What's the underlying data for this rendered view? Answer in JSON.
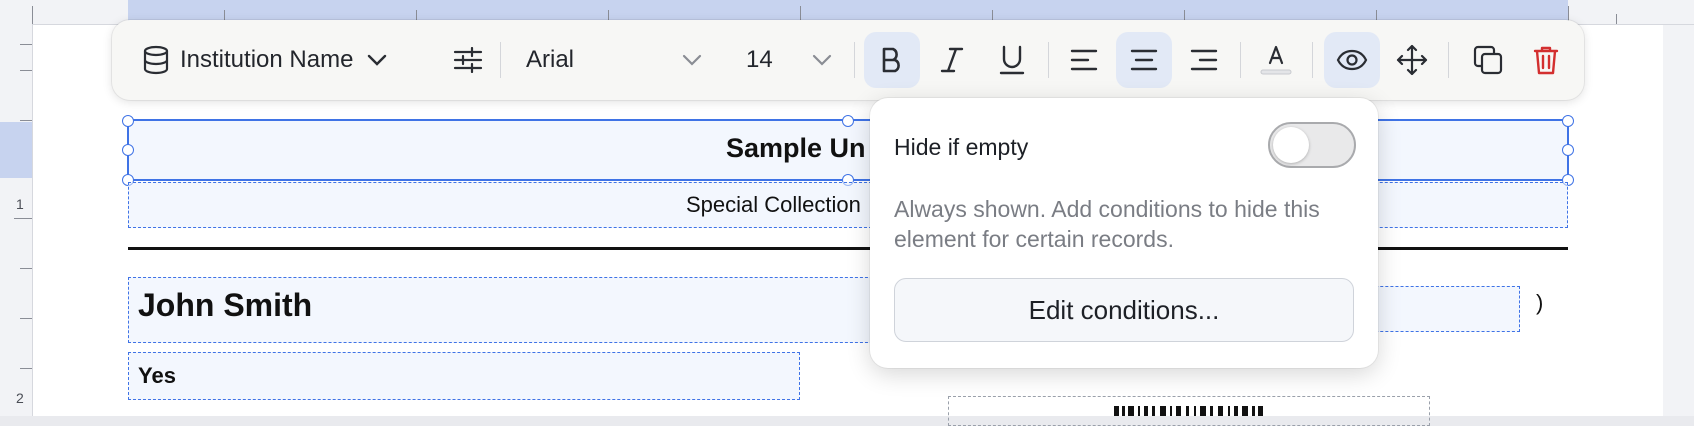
{
  "toolbar": {
    "field_icon": "database-icon",
    "field_name": "Institution Name",
    "font_family": "Arial",
    "font_size": "14",
    "accent_active_bg": "#e2e9f6",
    "delete_color": "#d32f2f",
    "icons": [
      "database-icon",
      "chevron-down-icon",
      "sliders-icon",
      "bold-icon",
      "italic-icon",
      "underline-icon",
      "align-left-icon",
      "align-center-icon",
      "align-right-icon",
      "text-color-icon",
      "eye-icon",
      "move-icon",
      "duplicate-icon",
      "trash-icon"
    ],
    "bold_active": true,
    "align_center_active": true,
    "visibility_active": true
  },
  "popover": {
    "toggle_label": "Hide if empty",
    "toggle_on": false,
    "description": "Always shown. Add conditions to hide this element for certain records.",
    "button_label": "Edit conditions..."
  },
  "document": {
    "title": "Sample Un",
    "subtitle": "Special Collection",
    "name": "John Smith",
    "yes": "Yes",
    "paren": ")"
  },
  "ruler": {
    "left_numbers": [
      "1",
      "2"
    ]
  }
}
